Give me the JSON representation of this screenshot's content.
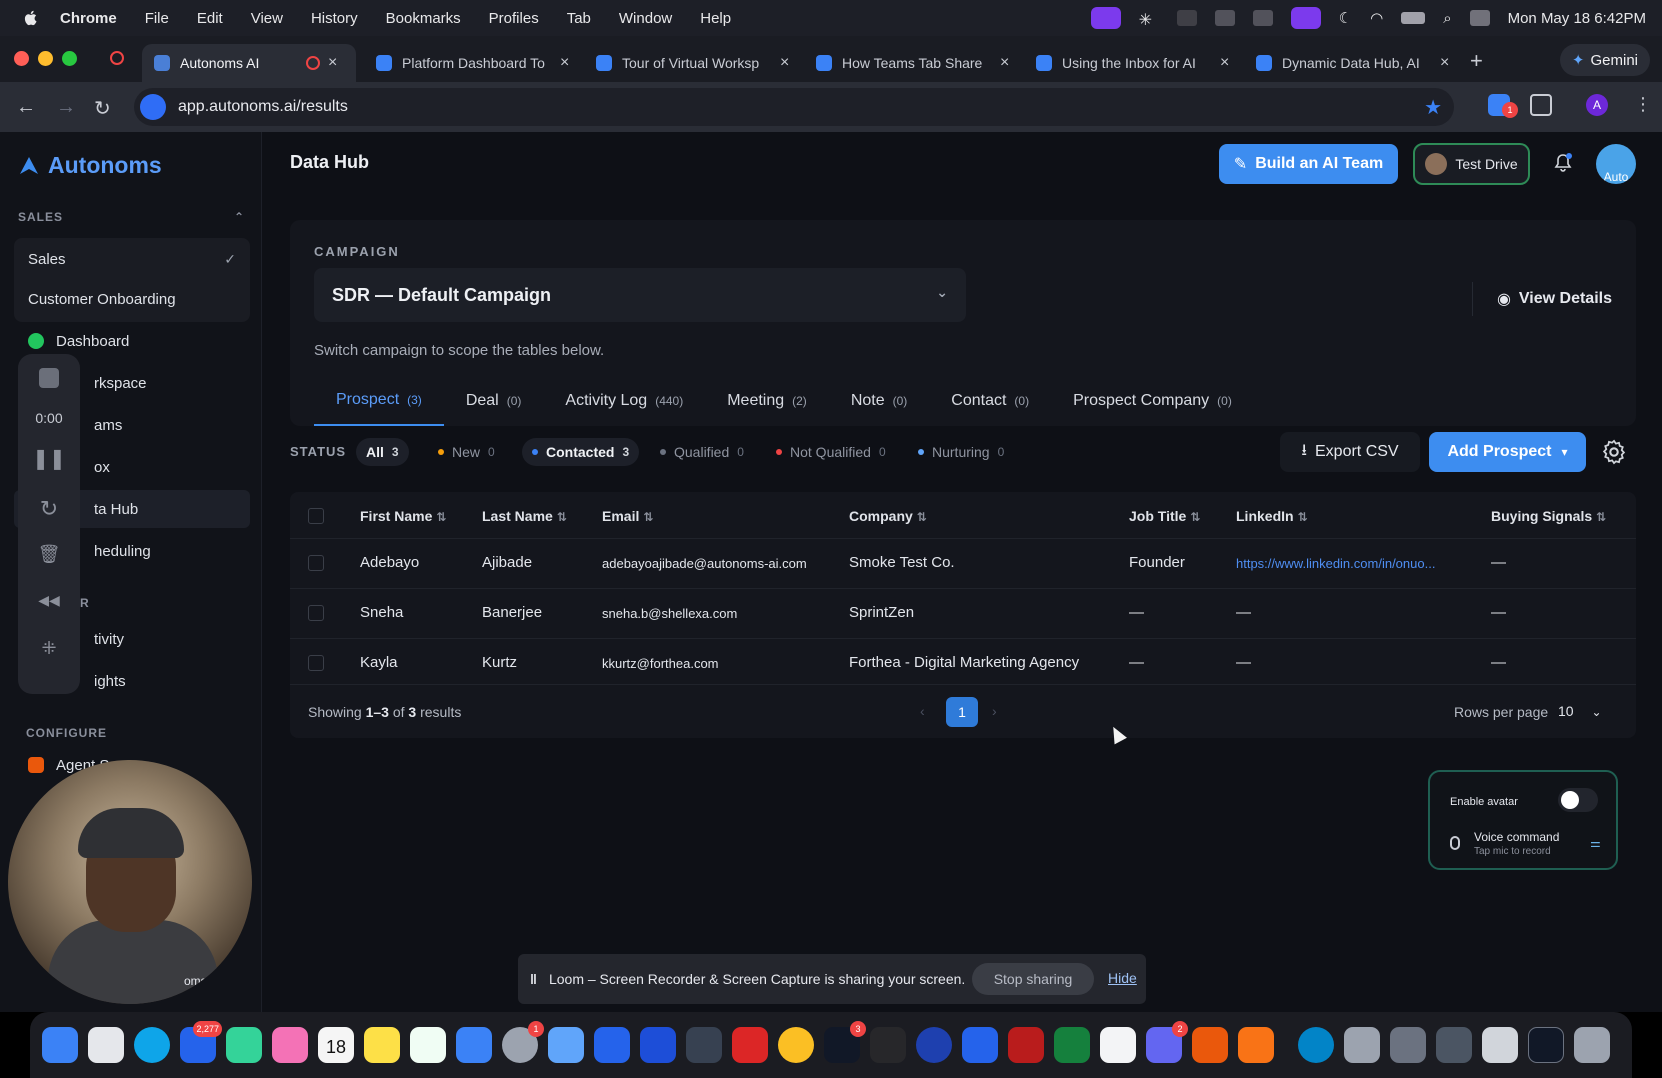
{
  "menubar": {
    "items": [
      "Chrome",
      "File",
      "Edit",
      "View",
      "History",
      "Bookmarks",
      "Profiles",
      "Tab",
      "Window",
      "Help"
    ],
    "datetime": "Mon May 18  6:42PM"
  },
  "browser": {
    "tabs": [
      {
        "title": "Autonoms AI",
        "active": true
      },
      {
        "title": "Platform Dashboard To",
        "active": false
      },
      {
        "title": "Tour of Virtual Worksp",
        "active": false
      },
      {
        "title": "How Teams Tab Share",
        "active": false
      },
      {
        "title": "Using the Inbox for AI",
        "active": false
      },
      {
        "title": "Dynamic Data Hub, AI",
        "active": false
      }
    ],
    "gemini_label": "Gemini",
    "url": "app.autonoms.ai/results",
    "profile_initial": "A",
    "ext_badge": "1"
  },
  "sidebar": {
    "brand": "Autonoms",
    "sales_section": "SALES",
    "items": [
      {
        "label": "Sales"
      },
      {
        "label": "Customer Onboarding"
      },
      {
        "label": "Dashboard"
      },
      {
        "label": "rkspace"
      },
      {
        "label": "ams"
      },
      {
        "label": "ox"
      },
      {
        "label": "ta Hub"
      },
      {
        "label": "heduling"
      },
      {
        "label": "R"
      },
      {
        "label": "tivity"
      },
      {
        "label": "ights"
      }
    ],
    "configure_section": "CONFIGURE",
    "agent_label": "Agent S",
    "loom_timer": "0:00",
    "webcam_caption": "oms-..."
  },
  "header": {
    "title": "Data Hub",
    "build_btn": "Build an AI Team",
    "test_drive": "Test Drive",
    "avatar_text": "Auto"
  },
  "campaign": {
    "label": "CAMPAIGN",
    "selected": "SDR — Default Campaign",
    "view_details": "View Details",
    "help": "Switch campaign to scope the tables below.",
    "tabs": [
      {
        "label": "Prospect",
        "count": "(3)"
      },
      {
        "label": "Deal",
        "count": "(0)"
      },
      {
        "label": "Activity Log",
        "count": "(440)"
      },
      {
        "label": "Meeting",
        "count": "(2)"
      },
      {
        "label": "Note",
        "count": "(0)"
      },
      {
        "label": "Contact",
        "count": "(0)"
      },
      {
        "label": "Prospect Company",
        "count": "(0)"
      }
    ]
  },
  "status": {
    "label": "STATUS",
    "filters": [
      {
        "label": "All",
        "count": "3",
        "color": ""
      },
      {
        "label": "New",
        "count": "0",
        "color": "#f59e0b"
      },
      {
        "label": "Contacted",
        "count": "3",
        "color": "#3b82f6"
      },
      {
        "label": "Qualified",
        "count": "0",
        "color": "#6b7280"
      },
      {
        "label": "Not Qualified",
        "count": "0",
        "color": "#ef4444"
      },
      {
        "label": "Nurturing",
        "count": "0",
        "color": "#60a5fa"
      }
    ],
    "export_btn": "Export CSV",
    "add_btn": "Add Prospect"
  },
  "table": {
    "columns": [
      "First Name",
      "Last Name",
      "Email",
      "Company",
      "Job Title",
      "LinkedIn",
      "Buying Signals"
    ],
    "rows": [
      [
        "Adebayo",
        "Ajibade",
        "adebayoajibade@autonoms-ai.com",
        "Smoke Test Co.",
        "Founder",
        "https://www.linkedin.com/in/onuo...",
        "—"
      ],
      [
        "Sneha",
        "Banerjee",
        "sneha.b@shellexa.com",
        "SprintZen",
        "—",
        "—",
        "—"
      ],
      [
        "Kayla",
        "Kurtz",
        "kkurtz@forthea.com",
        "Forthea - Digital Marketing Agency",
        "—",
        "—",
        "—"
      ]
    ],
    "showing_prefix": "Showing ",
    "showing_range": "1–3",
    "showing_mid": " of ",
    "showing_total": "3",
    "showing_suffix": " results",
    "current_page": "1",
    "rows_per_page_label": "Rows per page",
    "rows_per_page": "10"
  },
  "avatar_widget": {
    "enable_label": "Enable avatar",
    "voice_label": "Voice command",
    "voice_sub": "Tap mic to record"
  },
  "loom_bar": {
    "message": "Loom – Screen Recorder & Screen Capture is sharing your screen.",
    "stop": "Stop sharing",
    "hide": "Hide"
  },
  "dock": {
    "badges": {
      "mail": "2,277",
      "calendar": "18",
      "settings": "1",
      "terminal": "3",
      "teams": "2"
    }
  }
}
